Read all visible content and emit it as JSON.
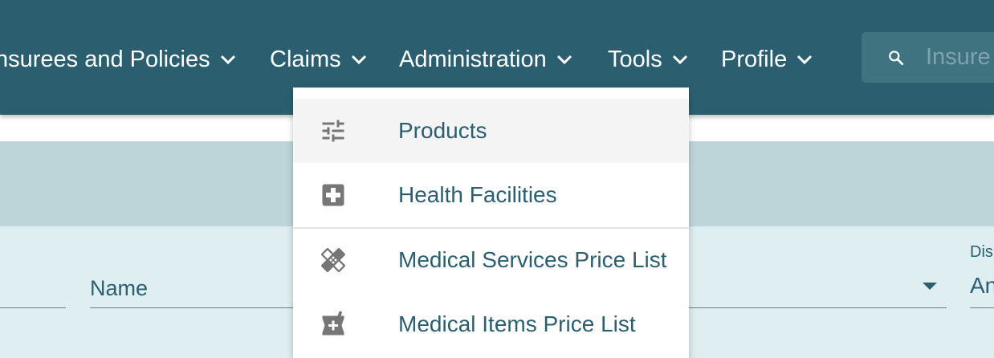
{
  "nav": {
    "items": [
      {
        "label": "nsurees and Policies"
      },
      {
        "label": "Claims"
      },
      {
        "label": "Administration"
      },
      {
        "label": "Tools"
      },
      {
        "label": "Profile"
      }
    ],
    "search": {
      "placeholder": "Insure"
    }
  },
  "filters": {
    "name_label": "Name",
    "district_label": "Dis",
    "district_value": "An"
  },
  "admin_menu": {
    "items": [
      {
        "label": "Products",
        "icon": "tune-icon"
      },
      {
        "label": "Health Facilities",
        "icon": "local-hospital-icon"
      },
      {
        "label": "Medical Services Price List",
        "icon": "healing-icon"
      },
      {
        "label": "Medical Items Price List",
        "icon": "medication-icon"
      }
    ]
  },
  "colors": {
    "appbar": "#2b5f70",
    "band_dark": "#bdd5d9",
    "band_light": "#dfeef1",
    "icon_gray": "#767676"
  }
}
